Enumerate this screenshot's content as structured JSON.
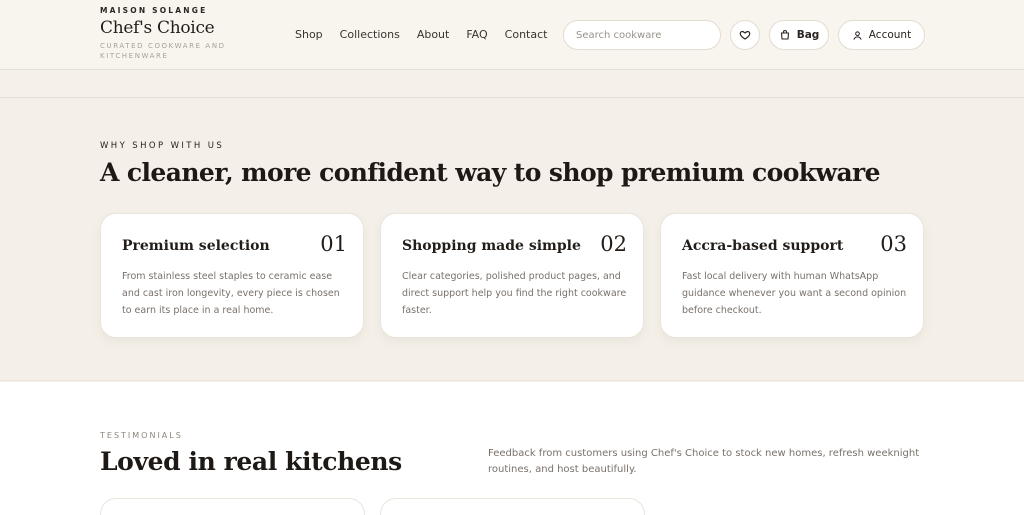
{
  "brand": {
    "kicker": "MAISON SOLANGE",
    "name": "Chef's Choice",
    "tagline": "CURATED COOKWARE AND KITCHENWARE"
  },
  "nav": [
    "Shop",
    "Collections",
    "About",
    "FAQ",
    "Contact"
  ],
  "search": {
    "placeholder": "Search cookware",
    "value": ""
  },
  "actions": {
    "bag_label": "Bag",
    "account_label": "Account"
  },
  "why": {
    "kicker": "WHY SHOP WITH US",
    "title": "A cleaner, more confident way to shop premium cookware",
    "cards": [
      {
        "title": "Premium selection",
        "number": "01",
        "body": "From stainless steel staples to ceramic ease and cast iron longevity, every piece is chosen to earn its place in a real home."
      },
      {
        "title": "Shopping made simple",
        "number": "02",
        "body": "Clear categories, polished product pages, and direct support help you find the right cookware faster."
      },
      {
        "title": "Accra-based support",
        "number": "03",
        "body": "Fast local delivery with human WhatsApp guidance whenever you want a second opinion before checkout."
      }
    ]
  },
  "testimonials": {
    "kicker": "TESTIMONIALS",
    "title": "Loved in real kitchens",
    "description": "Feedback from customers using Chef's Choice to stock new homes, refresh weeknight routines, and host beautifully."
  },
  "icons": {
    "wishlist": "heart-icon",
    "bag": "shopping-bag-icon",
    "account": "user-icon"
  },
  "colors": {
    "background": "#f4f0e9",
    "text": "#1f1915",
    "muted": "#7a716a",
    "card": "#ffffff"
  }
}
